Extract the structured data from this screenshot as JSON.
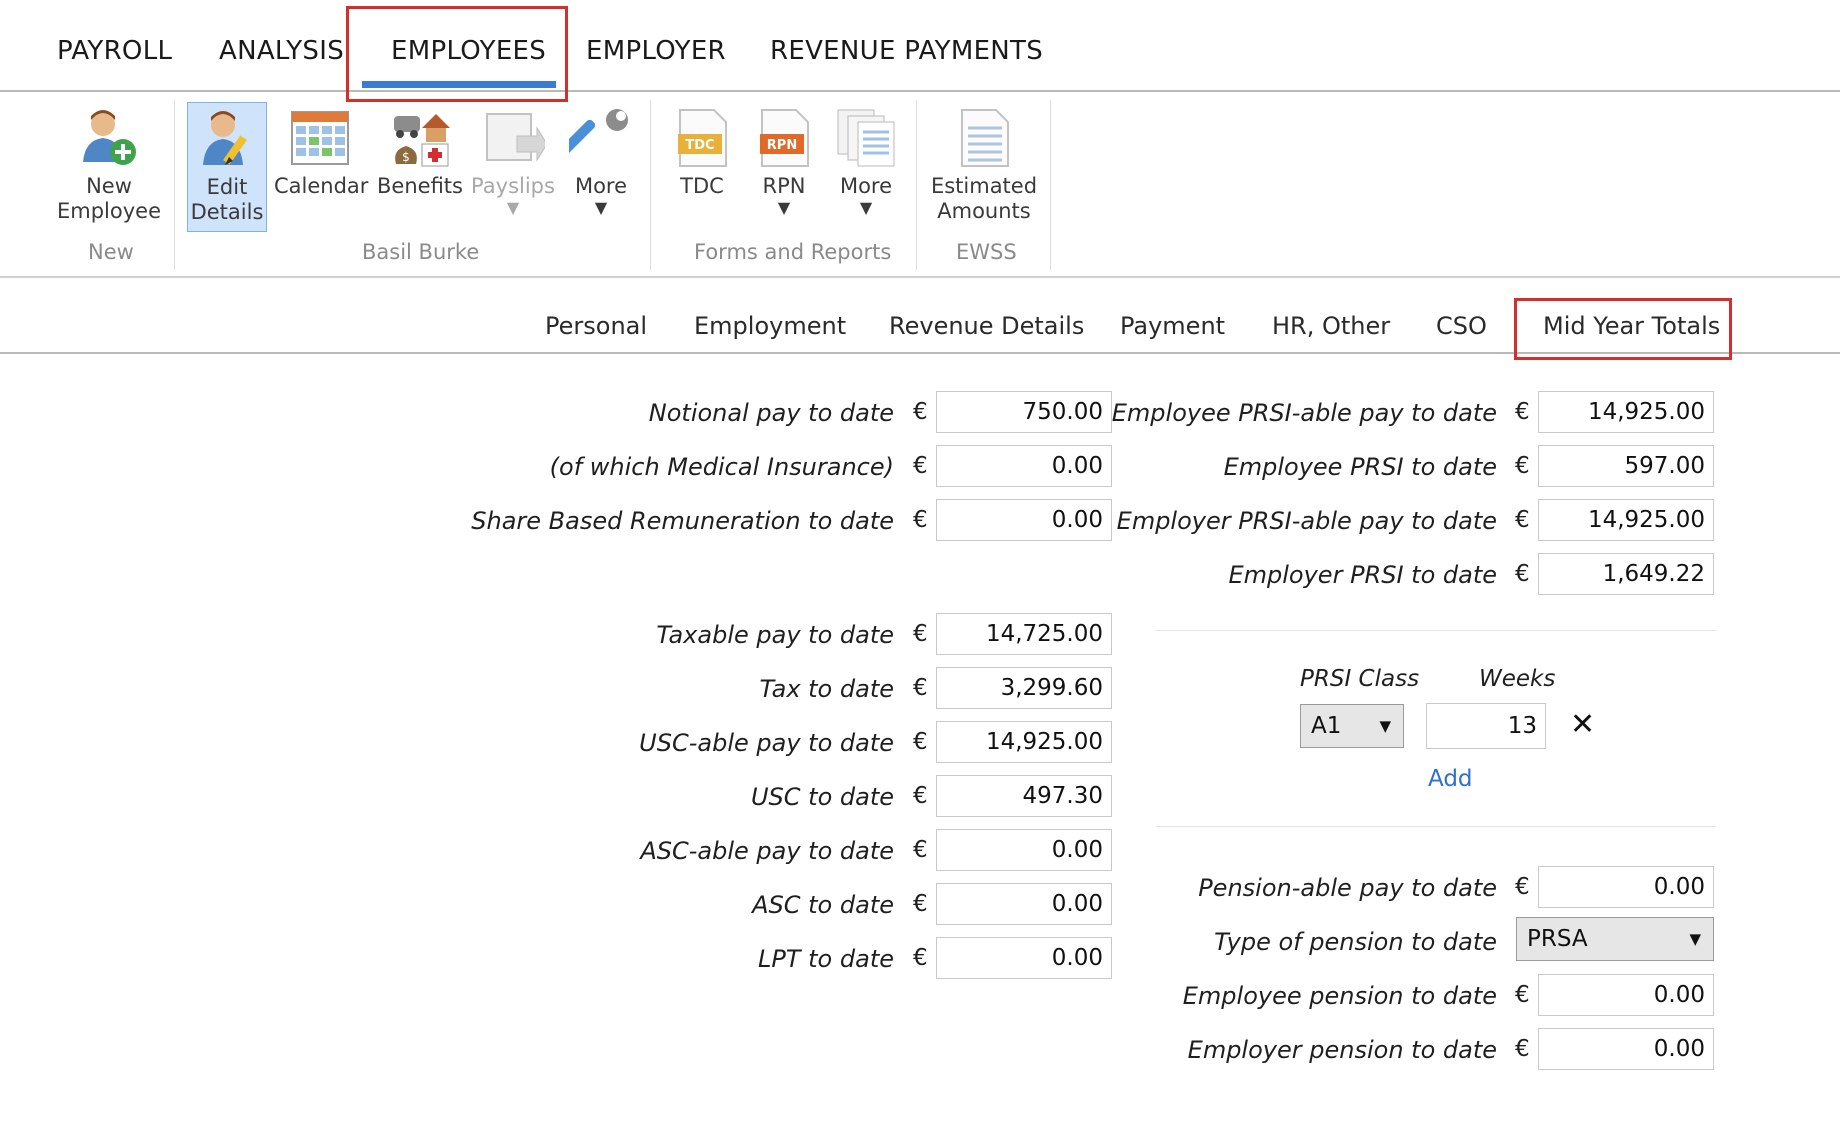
{
  "top_tabs": [
    "PAYROLL",
    "ANALYSIS",
    "EMPLOYEES",
    "EMPLOYER",
    "REVENUE PAYMENTS"
  ],
  "ribbon": {
    "new_employee": "New\nEmployee",
    "new_employee_l1": "New",
    "new_employee_l2": "Employee",
    "edit_l1": "Edit",
    "edit_l2": "Details",
    "calendar": "Calendar",
    "benefits": "Benefits",
    "payslips": "Payslips",
    "more1": "More",
    "tdc": "TDC",
    "rpn": "RPN",
    "more2": "More",
    "estimated_l1": "Estimated",
    "estimated_l2": "Amounts",
    "groups": [
      "New",
      "Basil Burke",
      "Forms and Reports",
      "EWSS"
    ],
    "icon_text_tdc": "TDC",
    "icon_text_rpn": "RPN"
  },
  "sub_tabs": [
    "Personal",
    "Employment",
    "Revenue Details",
    "Payment",
    "HR, Other",
    "CSO",
    "Mid Year Totals"
  ],
  "currency": "€",
  "left_fields": [
    {
      "label": "Notional pay to date",
      "value": "750.00"
    },
    {
      "label": "(of which Medical Insurance)",
      "value": "0.00"
    },
    {
      "label": "Share Based Remuneration to date",
      "value": "0.00"
    },
    {
      "label": "Taxable pay to date",
      "value": "14,725.00"
    },
    {
      "label": "Tax to date",
      "value": "3,299.60"
    },
    {
      "label": "USC-able pay to date",
      "value": "14,925.00"
    },
    {
      "label": "USC to date",
      "value": "497.30"
    },
    {
      "label": "ASC-able pay to date",
      "value": "0.00"
    },
    {
      "label": "ASC to date",
      "value": "0.00"
    },
    {
      "label": "LPT to date",
      "value": "0.00"
    }
  ],
  "right_fields": [
    {
      "label": "Employee PRSI-able pay to date",
      "value": "14,925.00"
    },
    {
      "label": "Employee PRSI to date",
      "value": "597.00"
    },
    {
      "label": "Employer PRSI-able pay to date",
      "value": "14,925.00"
    },
    {
      "label": "Employer PRSI to date",
      "value": "1,649.22"
    }
  ],
  "prsi": {
    "class_header": "PRSI Class",
    "weeks_header": "Weeks",
    "class_value": "A1",
    "weeks_value": "13",
    "add_label": "Add",
    "remove_symbol": "✕"
  },
  "pension": [
    {
      "label": "Pension-able pay to date",
      "value": "0.00"
    },
    {
      "label": "Type of pension to date",
      "value": "PRSA"
    },
    {
      "label": "Employee pension to date",
      "value": "0.00"
    },
    {
      "label": "Employer pension to date",
      "value": "0.00"
    }
  ],
  "colors": {
    "accent": "#3c7bd4",
    "highlight_box": "#d32f2f",
    "link": "#2f6fd0"
  }
}
